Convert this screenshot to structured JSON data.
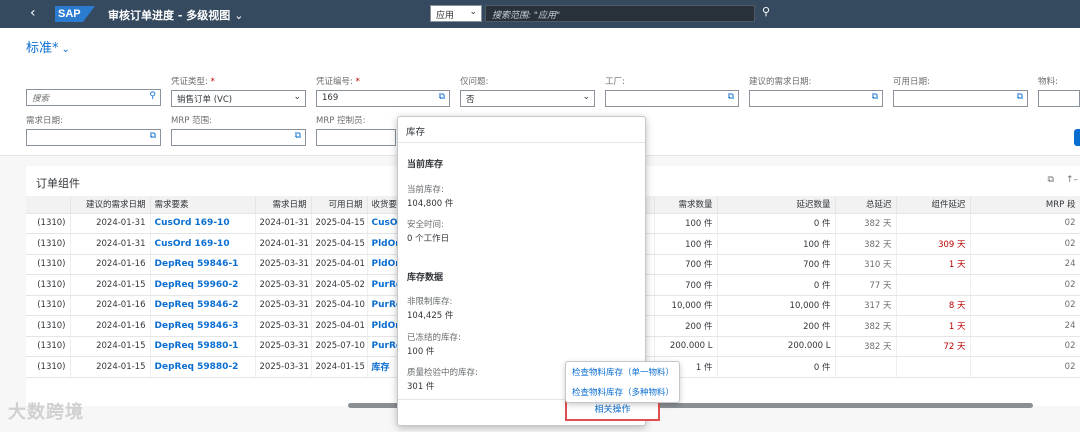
{
  "shell": {
    "logo": "SAP",
    "title": "审核订单进度 - 多级视图",
    "scope_value": "应用",
    "search_placeholder": "搜索范围: \"应用\""
  },
  "variant": "标准*",
  "filters": {
    "search_placeholder": "搜索",
    "voucher_type_label": "凭证类型:",
    "voucher_type_value": "销售订单 (VC)",
    "voucher_no_label": "凭证编号:",
    "voucher_no_value": "169",
    "only_issue_label": "仅问题:",
    "only_issue_value": "否",
    "plant_label": "工厂:",
    "suggested_date_label": "建议的需求日期:",
    "available_date_label": "可用日期:",
    "material_label": "物料:",
    "demand_date_label": "需求日期:",
    "mrp_range_label": "MRP 范围:",
    "mrp_controller_label": "MRP 控制员:"
  },
  "table": {
    "title": "订单组件",
    "columns": [
      "",
      "建议的需求日期",
      "需求要素",
      "需求日期",
      "可用日期",
      "收货要",
      "需求数量",
      "延迟数量",
      "总延迟",
      "组件延迟",
      "MRP 段"
    ],
    "rows": [
      {
        "c0": "(1310)",
        "c1": "2024-01-31",
        "c2": "CusOrd 169-10",
        "c3": "2024-01-31",
        "c4": "2025-04-15",
        "c5": "CusO",
        "c6": "100 件",
        "c7": "0 件",
        "c8": "382 天",
        "c9": "",
        "c10": "02"
      },
      {
        "c0": "(1310)",
        "c1": "2024-01-31",
        "c2": "CusOrd 169-10",
        "c3": "2024-01-31",
        "c4": "2025-04-15",
        "c5": "PldOr",
        "c6": "100 件",
        "c7": "100 件",
        "c8": "382 天",
        "c9": "309 天",
        "c10": "02"
      },
      {
        "c0": "(1310)",
        "c1": "2024-01-16",
        "c2": "DepReq 59846-1",
        "c3": "2025-03-31",
        "c4": "2025-04-01",
        "c5": "PldOr",
        "c6": "700 件",
        "c7": "700 件",
        "c8": "310 天",
        "c9": "1 天",
        "c10": "24"
      },
      {
        "c0": "(1310)",
        "c1": "2024-01-15",
        "c2": "DepReq 59960-2",
        "c3": "2025-03-31",
        "c4": "2024-05-02",
        "c5": "PurRe",
        "c6": "700 件",
        "c7": "0 件",
        "c8": "77 天",
        "c9": "",
        "c10": "02"
      },
      {
        "c0": "(1310)",
        "c1": "2024-01-16",
        "c2": "DepReq 59846-2",
        "c3": "2025-03-31",
        "c4": "2025-04-10",
        "c5": "PurRe",
        "c6": "10,000 件",
        "c7": "10,000 件",
        "c8": "317 天",
        "c9": "8 天",
        "c10": "02"
      },
      {
        "c0": "(1310)",
        "c1": "2024-01-16",
        "c2": "DepReq 59846-3",
        "c3": "2025-03-31",
        "c4": "2025-04-01",
        "c5": "PldOr",
        "c6": "200 件",
        "c7": "200 件",
        "c8": "382 天",
        "c9": "1 天",
        "c10": "24"
      },
      {
        "c0": "(1310)",
        "c1": "2024-01-15",
        "c2": "DepReq 59880-1",
        "c3": "2025-03-31",
        "c4": "2025-07-10",
        "c5": "PurRe",
        "c6": "200.000 L",
        "c7": "200.000 L",
        "c8": "382 天",
        "c9": "72 天",
        "c10": "02"
      },
      {
        "c0": "(1310)",
        "c1": "2024-01-15",
        "c2": "DepReq 59880-2",
        "c3": "2025-03-31",
        "c4": "2024-01-15",
        "c5": "库存",
        "c6": "1 件",
        "c7": "0 件",
        "c8": "",
        "c9": "",
        "c10": "02"
      }
    ]
  },
  "popover": {
    "title": "库存",
    "section1": "当前库存",
    "current_stock_label": "当前库存:",
    "current_stock_value": "104,800 件",
    "safety_time_label": "安全时间:",
    "safety_time_value": "0 个工作日",
    "section2": "库存数据",
    "unrestricted_label": "非限制库存:",
    "unrestricted_value": "104,425 件",
    "frozen_label": "已冻结的库存:",
    "frozen_value": "100 件",
    "qi_label": "质量检验中的库存:",
    "qi_value": "301 件",
    "related_actions": "相关操作"
  },
  "menu": {
    "item1": "检查物料库存（单一物料）",
    "item2": "检查物料库存（多种物料）"
  },
  "watermark": "大数跨境"
}
